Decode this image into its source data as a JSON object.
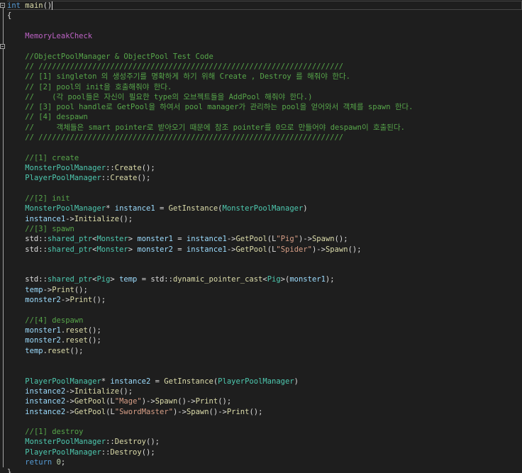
{
  "editor": {
    "language": "cpp",
    "caret_after_line": 0,
    "lines": [
      [
        [
          "kw",
          "int"
        ],
        [
          "pl",
          " "
        ],
        [
          "fn",
          "main"
        ],
        [
          "pl",
          "()"
        ]
      ],
      [
        [
          "pl",
          "{"
        ]
      ],
      [],
      [
        [
          "pl",
          "    "
        ],
        [
          "mc",
          "MemoryLeakCheck"
        ]
      ],
      [],
      [
        [
          "pl",
          "    "
        ],
        [
          "cm",
          "//ObjectPoolManager & ObjectPool Test Code"
        ]
      ],
      [
        [
          "pl",
          "    "
        ],
        [
          "cm",
          "// ////////////////////////////////////////////////////////////////////"
        ]
      ],
      [
        [
          "pl",
          "    "
        ],
        [
          "cm",
          "// [1] singleton 의 생성주기를 명확하게 하기 위해 Create , Destroy 를 해줘야 한다."
        ]
      ],
      [
        [
          "pl",
          "    "
        ],
        [
          "cm",
          "// [2] pool의 init을 호출해줘야 한다."
        ]
      ],
      [
        [
          "pl",
          "    "
        ],
        [
          "cm",
          "//    (각 pool들은 자신이 필요한 type의 오브젝트들을 AddPool 해줘야 한다.)"
        ]
      ],
      [
        [
          "pl",
          "    "
        ],
        [
          "cm",
          "// [3] pool handle로 GetPool을 하여서 pool manager가 관리하는 pool을 얻어와서 객체를 spawn 한다."
        ]
      ],
      [
        [
          "pl",
          "    "
        ],
        [
          "cm",
          "// [4] despawn"
        ]
      ],
      [
        [
          "pl",
          "    "
        ],
        [
          "cm",
          "//     객체들은 smart pointer로 받아오기 때문에 참조 pointer를 0으로 만들어야 despawn이 호출된다."
        ]
      ],
      [
        [
          "pl",
          "    "
        ],
        [
          "cm",
          "// ////////////////////////////////////////////////////////////////////"
        ]
      ],
      [],
      [
        [
          "pl",
          "    "
        ],
        [
          "cm",
          "//[1] create"
        ]
      ],
      [
        [
          "pl",
          "    "
        ],
        [
          "ty",
          "MonsterPoolManager"
        ],
        [
          "pl",
          "::"
        ],
        [
          "fn",
          "Create"
        ],
        [
          "pl",
          "();"
        ]
      ],
      [
        [
          "pl",
          "    "
        ],
        [
          "ty",
          "PlayerPoolManager"
        ],
        [
          "pl",
          "::"
        ],
        [
          "fn",
          "Create"
        ],
        [
          "pl",
          "();"
        ]
      ],
      [],
      [
        [
          "pl",
          "    "
        ],
        [
          "cm",
          "//[2] init"
        ]
      ],
      [
        [
          "pl",
          "    "
        ],
        [
          "ty",
          "MonsterPoolManager"
        ],
        [
          "pl",
          "* "
        ],
        [
          "vr",
          "instance1"
        ],
        [
          "pl",
          " = "
        ],
        [
          "fn",
          "GetInstance"
        ],
        [
          "pl",
          "("
        ],
        [
          "ty",
          "MonsterPoolManager"
        ],
        [
          "pl",
          ")"
        ]
      ],
      [
        [
          "pl",
          "    "
        ],
        [
          "vr",
          "instance1"
        ],
        [
          "pl",
          "->"
        ],
        [
          "fn",
          "Initialize"
        ],
        [
          "pl",
          "();"
        ]
      ],
      [
        [
          "pl",
          "    "
        ],
        [
          "cm",
          "//[3] spawn"
        ]
      ],
      [
        [
          "pl",
          "    std::"
        ],
        [
          "ty",
          "shared_ptr"
        ],
        [
          "pl",
          "<"
        ],
        [
          "ty",
          "Monster"
        ],
        [
          "pl",
          "> "
        ],
        [
          "vr",
          "monster1"
        ],
        [
          "pl",
          " = "
        ],
        [
          "vr",
          "instance1"
        ],
        [
          "pl",
          "->"
        ],
        [
          "fn",
          "GetPool"
        ],
        [
          "pl",
          "(L"
        ],
        [
          "st",
          "\"Pig\""
        ],
        [
          "pl",
          ")->"
        ],
        [
          "fn",
          "Spawn"
        ],
        [
          "pl",
          "();"
        ]
      ],
      [
        [
          "pl",
          "    std::"
        ],
        [
          "ty",
          "shared_ptr"
        ],
        [
          "pl",
          "<"
        ],
        [
          "ty",
          "Monster"
        ],
        [
          "pl",
          "> "
        ],
        [
          "vr",
          "monster2"
        ],
        [
          "pl",
          " = "
        ],
        [
          "vr",
          "instance1"
        ],
        [
          "pl",
          "->"
        ],
        [
          "fn",
          "GetPool"
        ],
        [
          "pl",
          "(L"
        ],
        [
          "st",
          "\"Spider\""
        ],
        [
          "pl",
          ")->"
        ],
        [
          "fn",
          "Spawn"
        ],
        [
          "pl",
          "();"
        ]
      ],
      [],
      [],
      [
        [
          "pl",
          "    std::"
        ],
        [
          "ty",
          "shared_ptr"
        ],
        [
          "pl",
          "<"
        ],
        [
          "ty",
          "Pig"
        ],
        [
          "pl",
          "> "
        ],
        [
          "vr",
          "temp"
        ],
        [
          "pl",
          " = std::"
        ],
        [
          "fn",
          "dynamic_pointer_cast"
        ],
        [
          "pl",
          "<"
        ],
        [
          "ty",
          "Pig"
        ],
        [
          "pl",
          ">("
        ],
        [
          "vr",
          "monster1"
        ],
        [
          "pl",
          ");"
        ]
      ],
      [
        [
          "pl",
          "    "
        ],
        [
          "vr",
          "temp"
        ],
        [
          "pl",
          "->"
        ],
        [
          "fn",
          "Print"
        ],
        [
          "pl",
          "();"
        ]
      ],
      [
        [
          "pl",
          "    "
        ],
        [
          "vr",
          "monster2"
        ],
        [
          "pl",
          "->"
        ],
        [
          "fn",
          "Print"
        ],
        [
          "pl",
          "();"
        ]
      ],
      [],
      [
        [
          "pl",
          "    "
        ],
        [
          "cm",
          "//[4] despawn"
        ]
      ],
      [
        [
          "pl",
          "    "
        ],
        [
          "vr",
          "monster1"
        ],
        [
          "pl",
          "."
        ],
        [
          "fn",
          "reset"
        ],
        [
          "pl",
          "();"
        ]
      ],
      [
        [
          "pl",
          "    "
        ],
        [
          "vr",
          "monster2"
        ],
        [
          "pl",
          "."
        ],
        [
          "fn",
          "reset"
        ],
        [
          "pl",
          "();"
        ]
      ],
      [
        [
          "pl",
          "    "
        ],
        [
          "vr",
          "temp"
        ],
        [
          "pl",
          "."
        ],
        [
          "fn",
          "reset"
        ],
        [
          "pl",
          "();"
        ]
      ],
      [],
      [],
      [
        [
          "pl",
          "    "
        ],
        [
          "ty",
          "PlayerPoolManager"
        ],
        [
          "pl",
          "* "
        ],
        [
          "vr",
          "instance2"
        ],
        [
          "pl",
          " = "
        ],
        [
          "fn",
          "GetInstance"
        ],
        [
          "pl",
          "("
        ],
        [
          "ty",
          "PlayerPoolManager"
        ],
        [
          "pl",
          ")"
        ]
      ],
      [
        [
          "pl",
          "    "
        ],
        [
          "vr",
          "instance2"
        ],
        [
          "pl",
          "->"
        ],
        [
          "fn",
          "Initialize"
        ],
        [
          "pl",
          "();"
        ]
      ],
      [
        [
          "pl",
          "    "
        ],
        [
          "vr",
          "instance2"
        ],
        [
          "pl",
          "->"
        ],
        [
          "fn",
          "GetPool"
        ],
        [
          "pl",
          "(L"
        ],
        [
          "st",
          "\"Mage\""
        ],
        [
          "pl",
          ")->"
        ],
        [
          "fn",
          "Spawn"
        ],
        [
          "pl",
          "()->"
        ],
        [
          "fn",
          "Print"
        ],
        [
          "pl",
          "();"
        ]
      ],
      [
        [
          "pl",
          "    "
        ],
        [
          "vr",
          "instance2"
        ],
        [
          "pl",
          "->"
        ],
        [
          "fn",
          "GetPool"
        ],
        [
          "pl",
          "(L"
        ],
        [
          "st",
          "\"SwordMaster\""
        ],
        [
          "pl",
          ")->"
        ],
        [
          "fn",
          "Spawn"
        ],
        [
          "pl",
          "()->"
        ],
        [
          "fn",
          "Print"
        ],
        [
          "pl",
          "();"
        ]
      ],
      [],
      [
        [
          "pl",
          "    "
        ],
        [
          "cm",
          "//[1] destroy"
        ]
      ],
      [
        [
          "pl",
          "    "
        ],
        [
          "ty",
          "MonsterPoolManager"
        ],
        [
          "pl",
          "::"
        ],
        [
          "fn",
          "Destroy"
        ],
        [
          "pl",
          "();"
        ]
      ],
      [
        [
          "pl",
          "    "
        ],
        [
          "ty",
          "PlayerPoolManager"
        ],
        [
          "pl",
          "::"
        ],
        [
          "fn",
          "Destroy"
        ],
        [
          "pl",
          "();"
        ]
      ],
      [
        [
          "pl",
          "    "
        ],
        [
          "kw",
          "return"
        ],
        [
          "pl",
          " "
        ],
        [
          "nm",
          "0"
        ],
        [
          "pl",
          ";"
        ]
      ],
      [
        [
          "pl",
          "}"
        ]
      ]
    ]
  }
}
